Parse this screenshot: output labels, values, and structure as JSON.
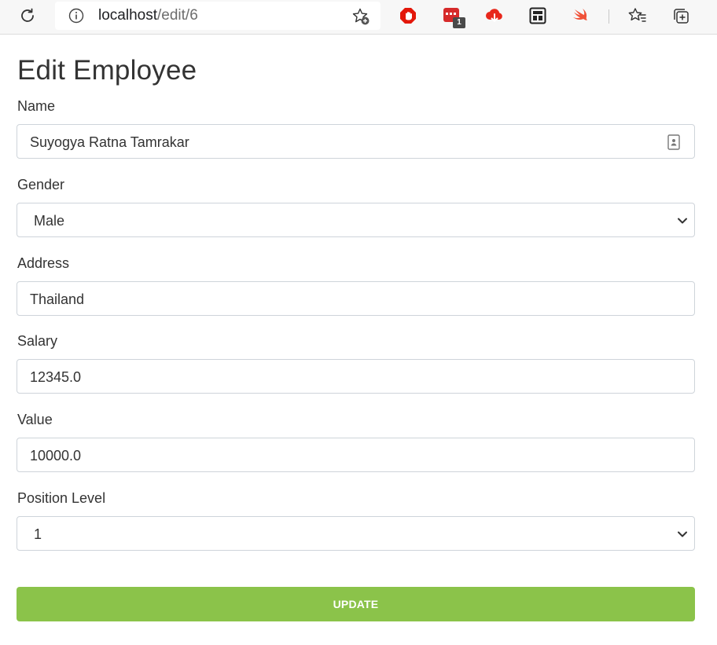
{
  "browser": {
    "url_host": "localhost",
    "url_path": "/edit/6",
    "extension_badge": "1",
    "icons": {
      "reload": "reload-icon",
      "info": "info-icon",
      "favorite_add": "add-favorite-icon",
      "extensions": [
        "adblock-icon",
        "extension-red-icon",
        "cloud-download-icon",
        "extension-dark-icon",
        "swift-icon"
      ],
      "favorites": "favorites-icon",
      "collections": "collections-icon"
    }
  },
  "form": {
    "title": "Edit Employee",
    "name_label": "Name",
    "name_value": "Suyogya Ratna Tamrakar",
    "gender_label": "Gender",
    "gender_value": "Male",
    "address_label": "Address",
    "address_value": "Thailand",
    "salary_label": "Salary",
    "salary_value": "12345.0",
    "value_label": "Value",
    "value_value": "10000.0",
    "position_label": "Position Level",
    "position_value": "1",
    "update_label": "UPDATE"
  },
  "colors": {
    "button": "#8bc34a",
    "field_border": "#ced4da",
    "toolbar": "#f7f7f7"
  }
}
